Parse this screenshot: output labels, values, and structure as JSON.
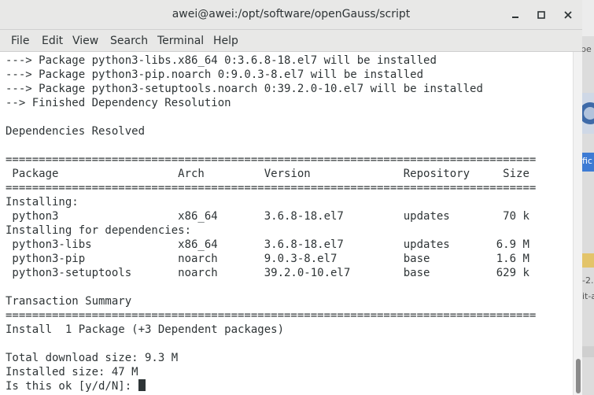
{
  "window": {
    "title": "awei@awei:/opt/software/openGauss/script"
  },
  "menu": [
    "File",
    "Edit",
    "View",
    "Search",
    "Terminal",
    "Help"
  ],
  "terminal": {
    "lines": [
      "---> Package python3-libs.x86_64 0:3.6.8-18.el7 will be installed",
      "---> Package python3-pip.noarch 0:9.0.3-8.el7 will be installed",
      "---> Package python3-setuptools.noarch 0:39.2.0-10.el7 will be installed",
      "--> Finished Dependency Resolution",
      "",
      "Dependencies Resolved",
      "",
      "================================================================================",
      " Package                  Arch         Version              Repository     Size",
      "================================================================================",
      "Installing:",
      " python3                  x86_64       3.6.8-18.el7         updates        70 k",
      "Installing for dependencies:",
      " python3-libs             x86_64       3.6.8-18.el7         updates       6.9 M",
      " python3-pip              noarch       9.0.3-8.el7          base          1.6 M",
      " python3-setuptools       noarch       39.2.0-10.el7        base          629 k",
      "",
      "Transaction Summary",
      "================================================================================",
      "Install  1 Package (+3 Dependent packages)",
      "",
      "Total download size: 9.3 M",
      "Installed size: 47 M"
    ],
    "prompt": "Is this ok [y/d/N]: "
  },
  "background_fragments": [
    "pe",
    "fic",
    "-2.",
    "it-a"
  ],
  "colors": {
    "text": "#2e3436",
    "titlebar": "#e8e8e7",
    "terminal_bg": "#ffffff",
    "scroll_thumb": "#8a8a8a"
  }
}
